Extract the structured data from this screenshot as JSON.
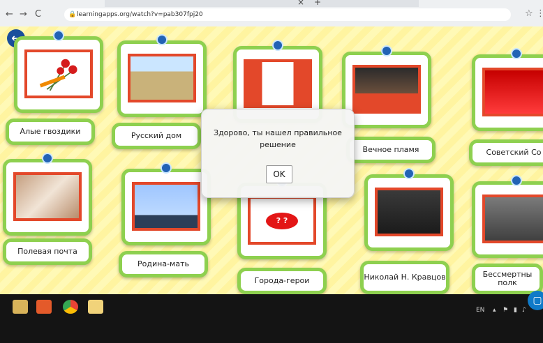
{
  "browser": {
    "url": "learningapps.org/watch?v=pab307fpj20",
    "back_glyph": "←",
    "forward_glyph": "→",
    "reload_glyph": "C",
    "tab_close_glyph": "×",
    "new_tab_glyph": "+",
    "star_glyph": "☆",
    "menu_glyph": "⋮",
    "lock_glyph": "🔒"
  },
  "app": {
    "back_glyph": "←",
    "cards": [
      {
        "label": "Алые гвоздики"
      },
      {
        "label": "Русский дом"
      },
      {
        "label": ""
      },
      {
        "label": "Вечное пламя"
      },
      {
        "label": "Советский Со"
      },
      {
        "label": "Полевая почта"
      },
      {
        "label": "Родина-мать"
      },
      {
        "label": "Города-герои"
      },
      {
        "label": "Николай Н. Кравцов"
      },
      {
        "label": "Бессмертны полк"
      }
    ],
    "cities_badge": "? ?"
  },
  "dialog": {
    "message": "Здорово, ты нашел правильное решение",
    "ok_label": "OK"
  },
  "taskbar": {
    "lang": "EN",
    "fab_glyph": "▢"
  },
  "colors": {
    "accent_green": "#8ed04f",
    "frame_red": "#e3482a",
    "pin_blue": "#2263b5"
  },
  "icons": {
    "back": "arrow-left-icon",
    "fab": "chat-icon"
  }
}
